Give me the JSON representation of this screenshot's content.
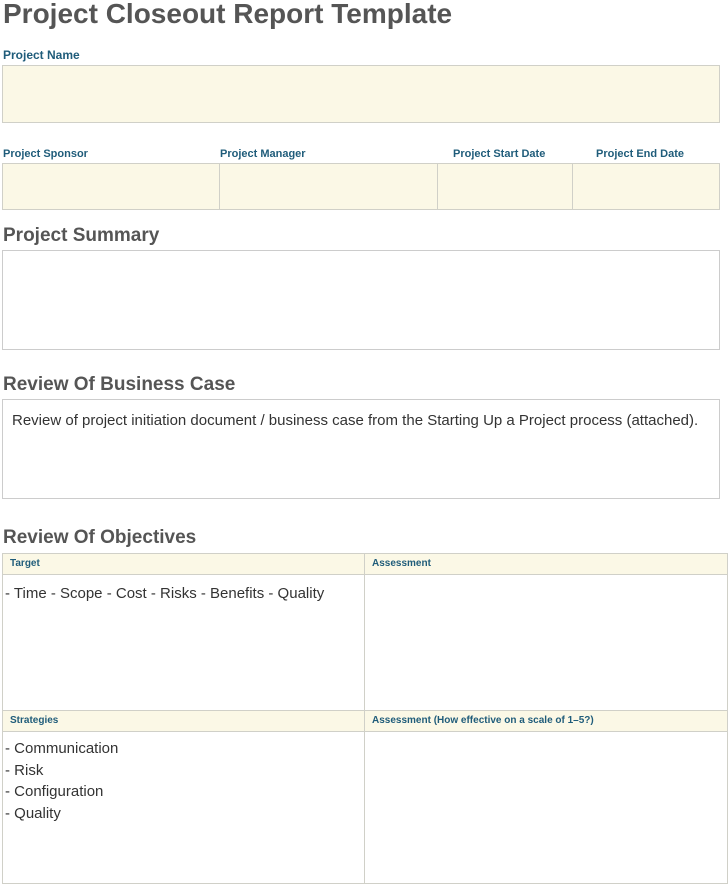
{
  "title": "Project Closeout Report Template",
  "fields": {
    "project_name": {
      "label": "Project Name",
      "value": ""
    },
    "project_sponsor": {
      "label": "Project Sponsor",
      "value": ""
    },
    "project_manager": {
      "label": "Project Manager",
      "value": ""
    },
    "project_start_date": {
      "label": "Project Start Date",
      "value": ""
    },
    "project_end_date": {
      "label": "Project End Date",
      "value": ""
    }
  },
  "summary": {
    "heading": "Project Summary",
    "value": ""
  },
  "business_case": {
    "heading": "Review Of Business Case",
    "text": "Review of project initiation document / business case from the Starting Up a Project process (attached)."
  },
  "objectives": {
    "heading": "Review Of Objectives",
    "target_header": "Target",
    "assessment_header": "Assessment",
    "target_text": "- Time - Scope - Cost - Risks - Benefits - Quality",
    "assessment_value": "",
    "strategies_header": "Strategies",
    "strategies_assessment_header": "Assessment (How effective on a scale of 1–5?)",
    "strategies": [
      "- Communication",
      "- Risk",
      "- Configuration",
      "- Quality"
    ],
    "strategies_assessment_value": ""
  }
}
